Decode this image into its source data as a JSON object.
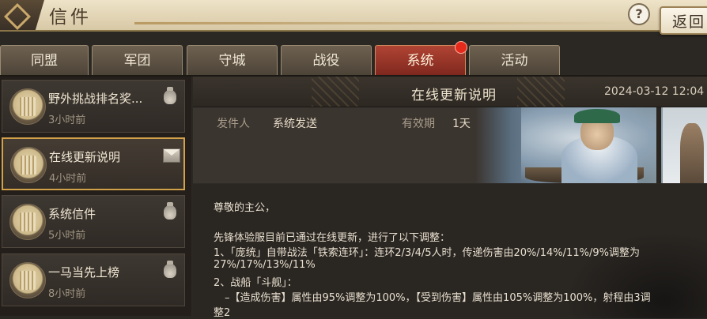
{
  "window": {
    "title": "信件",
    "help_label": "?",
    "back_label": "返回"
  },
  "tabs": [
    {
      "label": "同盟",
      "active": false
    },
    {
      "label": "军团",
      "active": false
    },
    {
      "label": "守城",
      "active": false
    },
    {
      "label": "战役",
      "active": false
    },
    {
      "label": "系统",
      "active": true,
      "has_notification": true
    },
    {
      "label": "活动",
      "active": false
    }
  ],
  "mail_list": [
    {
      "title": "野外挑战排名奖...",
      "time": "3小时前",
      "status_icon": "gift-bag-icon",
      "selected": false
    },
    {
      "title": "在线更新说明",
      "time": "4小时前",
      "status_icon": "open-envelope-icon",
      "selected": true
    },
    {
      "title": "系统信件",
      "time": "5小时前",
      "status_icon": "gift-bag-icon",
      "selected": false
    },
    {
      "title": "一马当先上榜",
      "time": "8小时前",
      "status_icon": "gift-bag-icon",
      "selected": false
    }
  ],
  "message": {
    "title": "在线更新说明",
    "date": "2024-03-12 12:04",
    "sender_label": "发件人",
    "sender": "系统发送",
    "validity_label": "有效期",
    "validity": "1天",
    "body_lines": [
      "尊敬的主公，",
      "先锋体验服目前已通过在线更新，进行了以下调整：",
      "1、「庞统」自带战法「铁索连环」：连环2/3/4/5人时，传递伤害由20%/14%/11%/9%调整为",
      "27%/17%/13%/11%",
      "2、战船「斗舰」：",
      "–【造成伤害】属性由95%调整为100%，【受到伤害】属性由105%调整为100%，射程由3调",
      "整2"
    ]
  },
  "colors": {
    "active_tab": "#a33a2c",
    "selected_border": "#d2a14a",
    "notification_dot": "#e52a1c"
  }
}
